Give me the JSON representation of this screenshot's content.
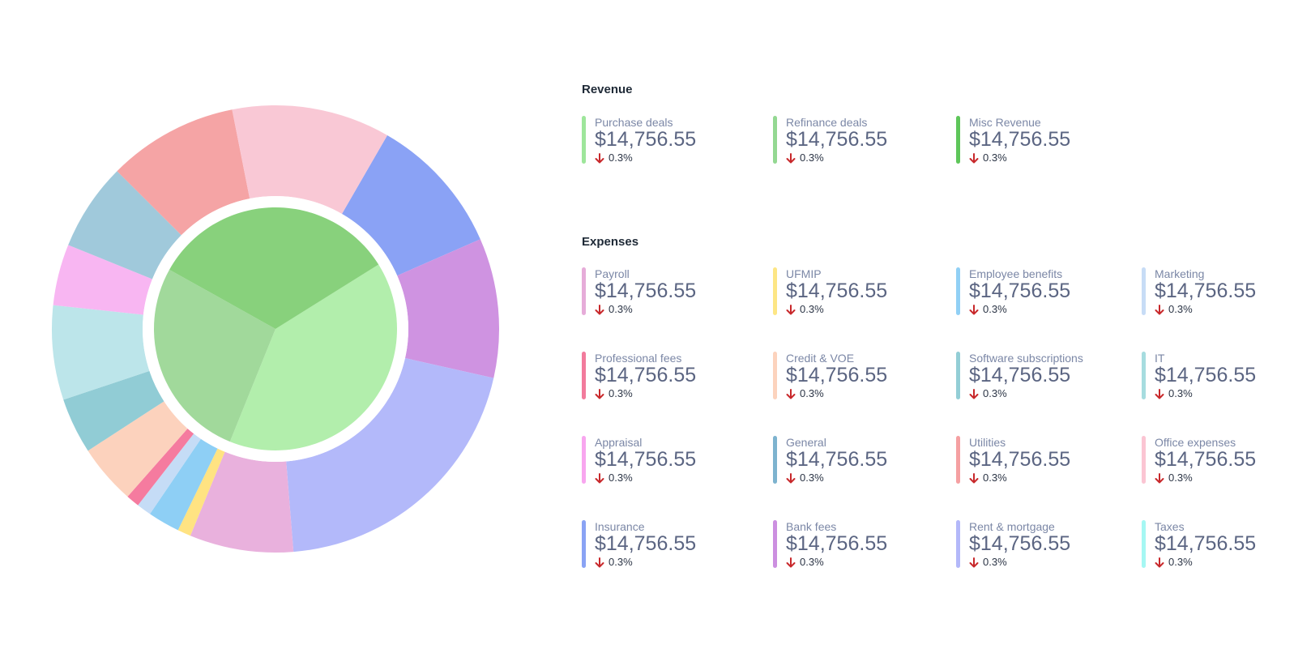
{
  "chart_data": {
    "type": "pie",
    "inner": {
      "slices": [
        {
          "value": 40,
          "color": "#b2eeac"
        },
        {
          "value": 27,
          "color": "#a1d99b"
        },
        {
          "value": 33,
          "color": "#88d17c"
        }
      ]
    },
    "outer": {
      "slices": [
        {
          "value": 10.5,
          "color": "#8aa2f5"
        },
        {
          "value": 10.5,
          "color": "#cf93e1"
        },
        {
          "value": 21.0,
          "color": "#b3b9fa"
        },
        {
          "value": 7.8,
          "color": "#e9b1dd"
        },
        {
          "value": 1.0,
          "color": "#ffe382"
        },
        {
          "value": 2.4,
          "color": "#8ecff5"
        },
        {
          "value": 1.1,
          "color": "#c5dcf6"
        },
        {
          "value": 1.0,
          "color": "#f57b9f"
        },
        {
          "value": 4.5,
          "color": "#fcd2bd"
        },
        {
          "value": 4.2,
          "color": "#91ccd5"
        },
        {
          "value": 7.1,
          "color": "#bce5ea"
        },
        {
          "value": 4.6,
          "color": "#f8b6f2"
        },
        {
          "value": 6.6,
          "color": "#a0c9db"
        },
        {
          "value": 9.8,
          "color": "#f5a4a5"
        },
        {
          "value": 11.9,
          "color": "#f9c8d5"
        }
      ]
    }
  },
  "revenue": {
    "title": "Revenue",
    "items": [
      {
        "label": "Purchase deals",
        "value": "$14,756.55",
        "change": "0.3%",
        "color": "#9ee69b"
      },
      {
        "label": "Refinance deals",
        "value": "$14,756.55",
        "change": "0.3%",
        "color": "#94d892"
      },
      {
        "label": "Misc Revenue",
        "value": "$14,756.55",
        "change": "0.3%",
        "color": "#5ec65a"
      }
    ]
  },
  "expenses": {
    "title": "Expenses",
    "items": [
      {
        "label": "Payroll",
        "value": "$14,756.55",
        "change": "0.3%",
        "color": "#e6acd9"
      },
      {
        "label": "UFMIP",
        "value": "$14,756.55",
        "change": "0.3%",
        "color": "#fde685"
      },
      {
        "label": "Employee benefits",
        "value": "$14,756.55",
        "change": "0.3%",
        "color": "#91d0f5"
      },
      {
        "label": "Marketing",
        "value": "$14,756.55",
        "change": "0.3%",
        "color": "#c7dcf6"
      },
      {
        "label": "Professional fees",
        "value": "$14,756.55",
        "change": "0.3%",
        "color": "#f27b9c"
      },
      {
        "label": "Credit & VOE",
        "value": "$14,756.55",
        "change": "0.3%",
        "color": "#fcd3bd"
      },
      {
        "label": "Software subscriptions",
        "value": "$14,756.55",
        "change": "0.3%",
        "color": "#93ced6"
      },
      {
        "label": "IT",
        "value": "$14,756.55",
        "change": "0.3%",
        "color": "#a6dcdf"
      },
      {
        "label": "Appraisal",
        "value": "$14,756.55",
        "change": "0.3%",
        "color": "#f8a6ef"
      },
      {
        "label": "General",
        "value": "$14,756.55",
        "change": "0.3%",
        "color": "#7db3cf"
      },
      {
        "label": "Utilities",
        "value": "$14,756.55",
        "change": "0.3%",
        "color": "#f5a0a2"
      },
      {
        "label": "Office expenses",
        "value": "$14,756.55",
        "change": "0.3%",
        "color": "#fbc5d3"
      },
      {
        "label": "Insurance",
        "value": "$14,756.55",
        "change": "0.3%",
        "color": "#8aa3f4"
      },
      {
        "label": "Bank fees",
        "value": "$14,756.55",
        "change": "0.3%",
        "color": "#cc8fe0"
      },
      {
        "label": "Rent & mortgage",
        "value": "$14,756.55",
        "change": "0.3%",
        "color": "#b3b8f9"
      },
      {
        "label": "Taxes",
        "value": "$14,756.55",
        "change": "0.3%",
        "color": "#a5f7f3"
      }
    ]
  },
  "trend_icon": "arrow-down-icon",
  "trend_color": "#c8282b"
}
